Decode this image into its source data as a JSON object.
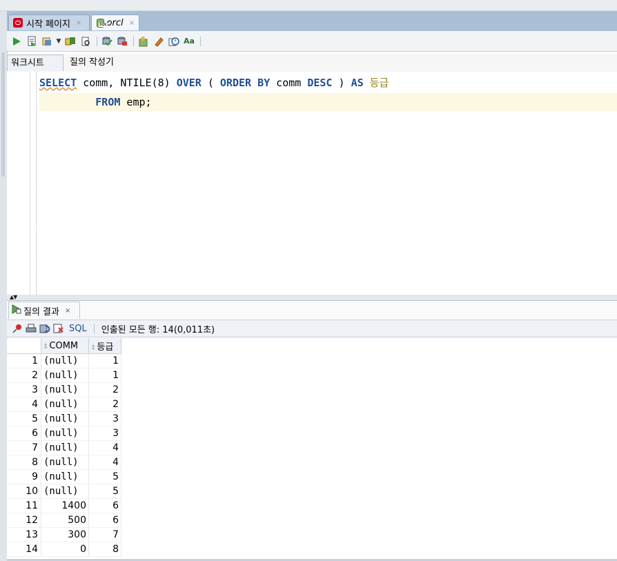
{
  "doc_tabs": [
    {
      "label": "시작 페이지",
      "close": "×"
    },
    {
      "label": "orcl",
      "close": "×"
    }
  ],
  "subtabs": {
    "worksheet": "워크시트",
    "query_builder": "질의 작성기"
  },
  "editor": {
    "line1": {
      "select": "SELECT",
      "cols": " comm, ",
      "fn": "NTILE",
      "arg": "(8) ",
      "over": "OVER",
      "p1": " ( ",
      "orderby": "ORDER BY",
      "comm": " comm ",
      "desc": "DESC",
      "p2": " ) ",
      "as": "AS",
      "alias": " 등급"
    },
    "line2": {
      "indent": "         ",
      "from": "FROM",
      "rest": " emp;"
    }
  },
  "result_tab": {
    "label": "질의 결과",
    "close": "×"
  },
  "result_toolbar": {
    "sql_label": "SQL",
    "status": "인출된 모든 행: 14(0,011초)"
  },
  "grid": {
    "columns": [
      "COMM",
      "등급"
    ],
    "rows": [
      {
        "n": "1",
        "comm": "(null)",
        "grade": "1"
      },
      {
        "n": "2",
        "comm": "(null)",
        "grade": "1"
      },
      {
        "n": "3",
        "comm": "(null)",
        "grade": "2"
      },
      {
        "n": "4",
        "comm": "(null)",
        "grade": "2"
      },
      {
        "n": "5",
        "comm": "(null)",
        "grade": "3"
      },
      {
        "n": "6",
        "comm": "(null)",
        "grade": "3"
      },
      {
        "n": "7",
        "comm": "(null)",
        "grade": "4"
      },
      {
        "n": "8",
        "comm": "(null)",
        "grade": "4"
      },
      {
        "n": "9",
        "comm": "(null)",
        "grade": "5"
      },
      {
        "n": "10",
        "comm": "(null)",
        "grade": "5"
      },
      {
        "n": "11",
        "comm": "1400",
        "grade": "6"
      },
      {
        "n": "12",
        "comm": "500",
        "grade": "6"
      },
      {
        "n": "13",
        "comm": "300",
        "grade": "7"
      },
      {
        "n": "14",
        "comm": "0",
        "grade": "8"
      }
    ]
  }
}
